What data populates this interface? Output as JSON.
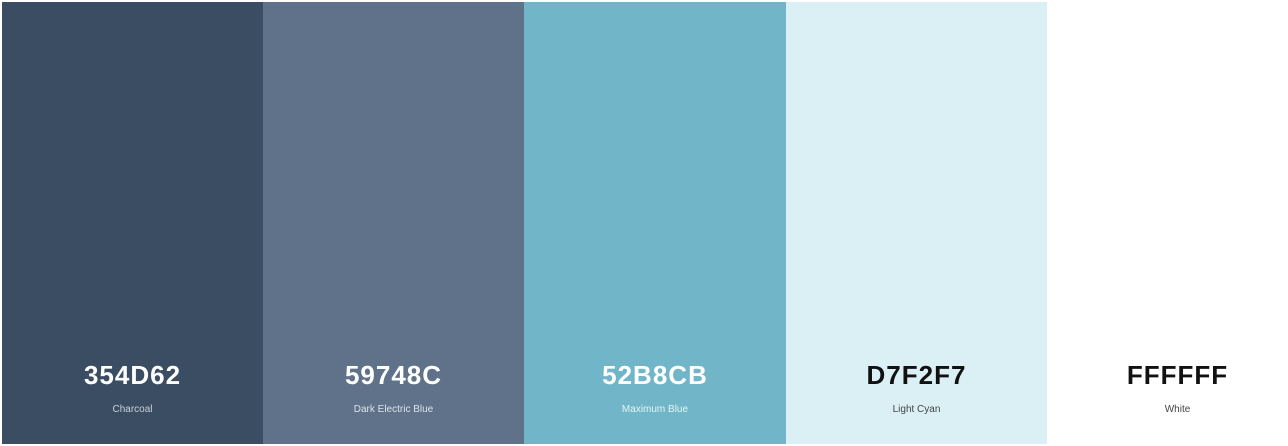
{
  "palette": {
    "colors": [
      {
        "hex": "354D62",
        "name": "Charcoal",
        "swatch": "#354D62"
      },
      {
        "hex": "59748C",
        "name": "Dark Electric Blue",
        "swatch": "#59748C"
      },
      {
        "hex": "52B8CB",
        "name": "Maximum Blue",
        "swatch": "#52B8CB"
      },
      {
        "hex": "D7F2F7",
        "name": "Light Cyan",
        "swatch": "#D7F2F7"
      },
      {
        "hex": "FFFFFF",
        "name": "White",
        "swatch": "#FFFFFF"
      }
    ]
  }
}
